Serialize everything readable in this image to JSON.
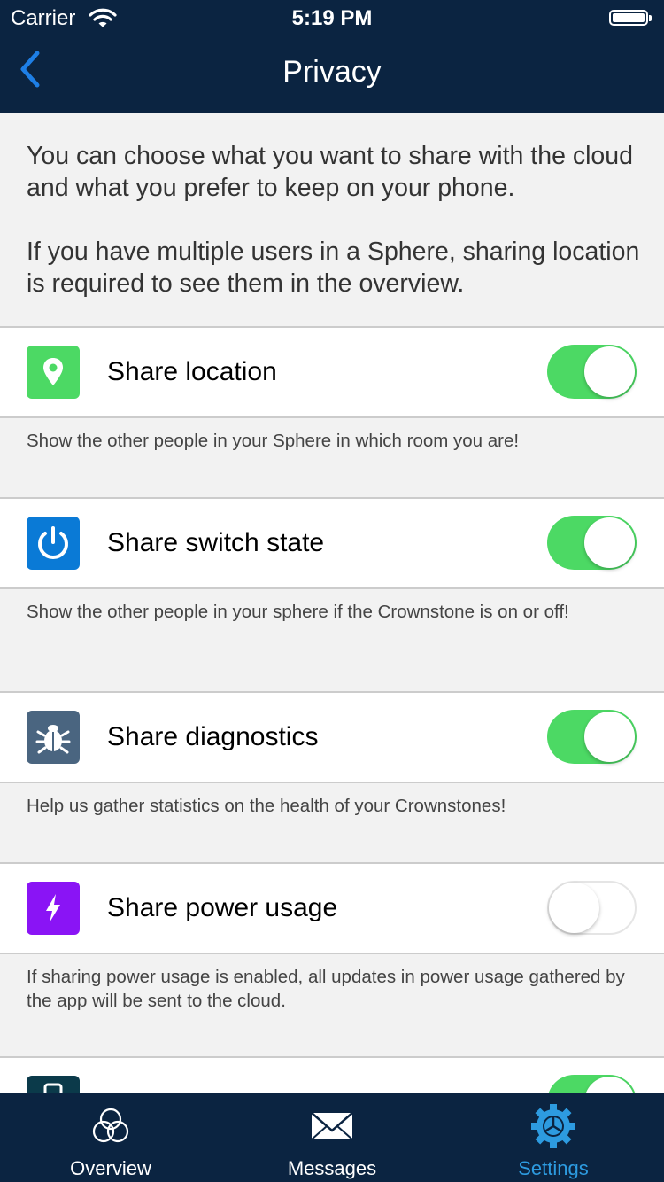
{
  "status_bar": {
    "carrier": "Carrier",
    "time": "5:19 PM"
  },
  "nav": {
    "title": "Privacy"
  },
  "intro": {
    "paragraph1": "You can choose what you want to share with the cloud and what you prefer to keep on your phone.",
    "paragraph2": "If you have multiple users in a Sphere, sharing location is required to see them in the overview."
  },
  "settings": [
    {
      "label": "Share location",
      "icon": "location-pin-icon",
      "icon_color": "#4cd964",
      "enabled": true,
      "description": "Show the other people in your Sphere in which room you are!"
    },
    {
      "label": "Share switch state",
      "icon": "power-icon",
      "icon_color": "#0a7ad6",
      "enabled": true,
      "description": "Show the other people in your sphere if the Crownstone is on or off!"
    },
    {
      "label": "Share diagnostics",
      "icon": "bug-icon",
      "icon_color": "#4a6580",
      "enabled": true,
      "description": "Help us gather statistics on the health of your Crownstones!"
    },
    {
      "label": "Share power usage",
      "icon": "lightning-icon",
      "icon_color": "#8a14f5",
      "enabled": false,
      "description": "If sharing power usage is enabled, all updates in power usage gathered by the app will be sent to the cloud."
    },
    {
      "icon": "phone-icon",
      "icon_color": "#0b3a4a",
      "enabled": true
    }
  ],
  "tabs": [
    {
      "label": "Overview",
      "icon": "overview-circles-icon",
      "active": false
    },
    {
      "label": "Messages",
      "icon": "envelope-icon",
      "active": false
    },
    {
      "label": "Settings",
      "icon": "gear-icon",
      "active": true
    }
  ],
  "colors": {
    "header_bg": "#0b2441",
    "toggle_on": "#4cd964",
    "tab_active": "#2d9be0"
  }
}
